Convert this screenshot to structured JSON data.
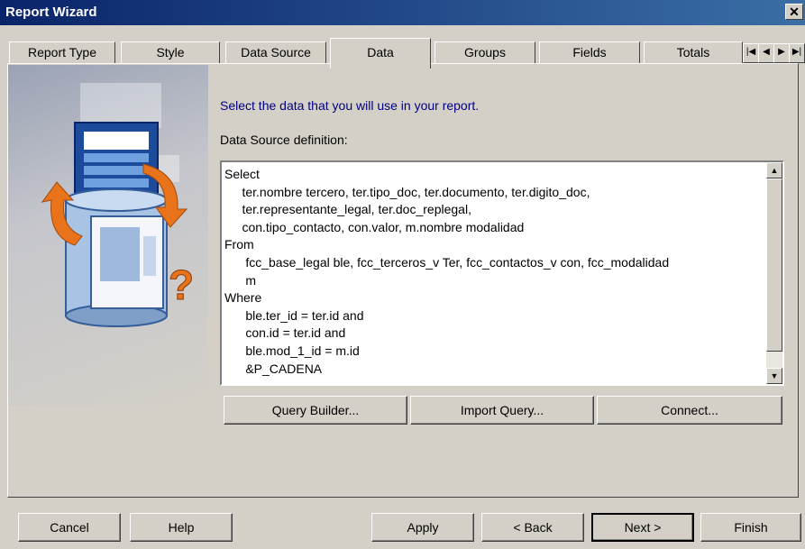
{
  "window": {
    "title": "Report Wizard",
    "close_glyph": "✕"
  },
  "tabs": [
    {
      "label": "Report Type"
    },
    {
      "label": "Style"
    },
    {
      "label": "Data Source"
    },
    {
      "label": "Data"
    },
    {
      "label": "Groups"
    },
    {
      "label": "Fields"
    },
    {
      "label": "Totals"
    }
  ],
  "tab_nav": [
    "|◀",
    "◀",
    "▶",
    "▶|"
  ],
  "main": {
    "instruction": "Select the data that you will use in your report.",
    "definition_label": "Data Source definition:",
    "sql": "Select\n     ter.nombre tercero, ter.tipo_doc, ter.documento, ter.digito_doc,\n     ter.representante_legal, ter.doc_replegal,\n     con.tipo_contacto, con.valor, m.nombre modalidad\nFrom\n      fcc_base_legal ble, fcc_terceros_v Ter, fcc_contactos_v con, fcc_modalidad\n      m\nWhere\n      ble.ter_id = ter.id and\n      con.id = ter.id and\n      ble.mod_1_id = m.id\n      &P_CADENA"
  },
  "query_buttons": {
    "query_builder": "Query Builder...",
    "import_query": "Import Query...",
    "connect": "Connect..."
  },
  "footer": {
    "cancel": "Cancel",
    "help": "Help",
    "apply": "Apply",
    "back": "< Back",
    "next": "Next >",
    "finish": "Finish"
  }
}
